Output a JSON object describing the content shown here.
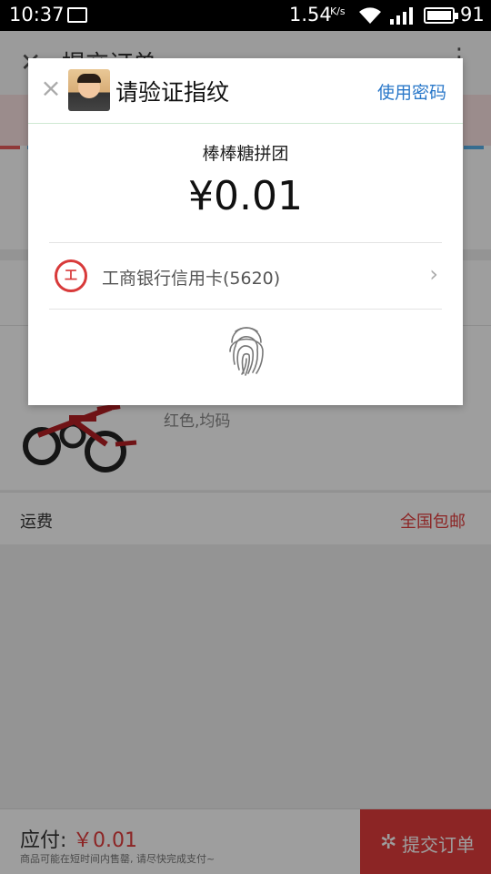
{
  "status_bar": {
    "time": "10:37",
    "net_speed": "1.54",
    "net_unit": "K/s",
    "battery": "91",
    "icons": [
      "image-icon",
      "wifi-icon",
      "signal-icon",
      "battery-icon"
    ]
  },
  "page": {
    "title": "提交订单",
    "back_icon": "back-arrow-icon",
    "more_icon": "more-icon",
    "product_attr": "红色,均码",
    "shipping_label": "运费",
    "shipping_value": "全国包邮",
    "pay_label": "应付:",
    "pay_amount": "￥0.01",
    "pay_note": "商品可能在短时间内售罄, 请尽快完成支付~",
    "submit_label": "提交订单"
  },
  "dialog": {
    "title": "请验证指纹",
    "alt_action": "使用密码",
    "merchant": "棒棒糖拼团",
    "amount": "¥0.01",
    "payment_method": "工商银行信用卡(5620)",
    "bank_icon": "icbc-logo-icon",
    "fingerprint_icon": "fingerprint-icon"
  },
  "colors": {
    "accent_red": "#e23c3c",
    "link_blue": "#2a78c9"
  }
}
